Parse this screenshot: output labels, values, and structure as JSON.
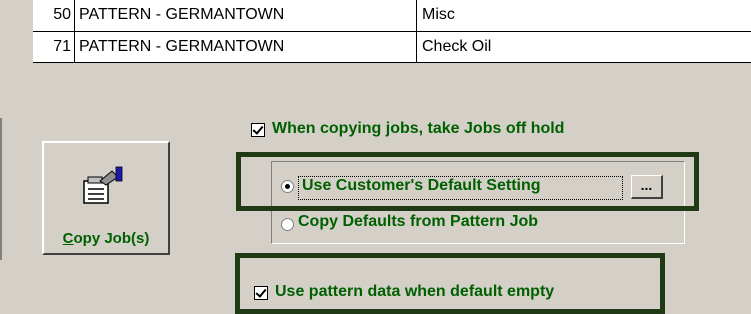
{
  "grid": {
    "rows": [
      {
        "num": "50",
        "pattern": "PATTERN - GERMANTOWN",
        "desc": "Misc"
      },
      {
        "num": "71",
        "pattern": "PATTERN - GERMANTOWN",
        "desc": "Check Oil"
      }
    ]
  },
  "copy_button": {
    "label_underlined": "C",
    "label_rest": "opy Job(s)",
    "icon": "copy-jobs-icon"
  },
  "options": {
    "take_off_hold": {
      "label": "When copying jobs, take Jobs off hold",
      "checked": true
    },
    "use_customer_default": {
      "label": "Use  Customer's Default Setting",
      "selected": true
    },
    "copy_from_pattern": {
      "label": "Copy Defaults from Pattern Job",
      "selected": false
    },
    "ellipsis_label": "...",
    "use_pattern_data": {
      "label": "Use pattern data when default empty",
      "checked": true
    }
  },
  "colors": {
    "label_green": "#006000",
    "highlight": "#1f3a14",
    "background": "#d4d0c8"
  }
}
